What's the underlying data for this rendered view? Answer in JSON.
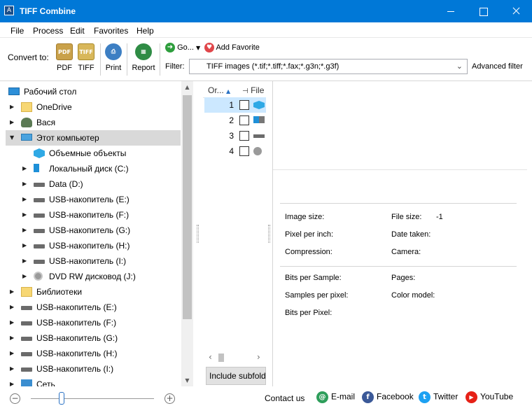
{
  "window": {
    "title": "TIFF Combine",
    "icon_glyph": "A"
  },
  "menu": [
    "File",
    "Process",
    "Edit",
    "Favorites",
    "Help"
  ],
  "toolbar": {
    "convert_label": "Convert to:",
    "buttons": [
      {
        "label": "PDF",
        "icon": "pdf-icon",
        "glyph": "PDF"
      },
      {
        "label": "TIFF",
        "icon": "tiff-icon",
        "glyph": "TIFF"
      },
      {
        "label": "Print",
        "icon": "print-icon",
        "glyph": "⎙"
      },
      {
        "label": "Report",
        "icon": "report-icon",
        "glyph": "▦"
      }
    ],
    "go_label": "Go...",
    "go_glyph": "➜",
    "add_favorite_label": "Add Favorite",
    "fav_glyph": "♥",
    "filter_label": "Filter:",
    "filter_value": "TIFF images (*.tif;*.tiff;*.fax;*.g3n;*.g3f)",
    "advanced_filter_label": "Advanced filter"
  },
  "tree": {
    "items": [
      {
        "label": "Рабочий стол",
        "icon": "desktop-icon",
        "level": 0,
        "arrow": ""
      },
      {
        "label": "OneDrive",
        "icon": "folder-icon",
        "level": 1,
        "arrow": "▶"
      },
      {
        "label": "Вася",
        "icon": "user-icon",
        "level": 1,
        "arrow": "▶"
      },
      {
        "label": "Этот компьютер",
        "icon": "computer-icon",
        "level": 1,
        "arrow": "▼",
        "selected": true
      },
      {
        "label": "Объемные объекты",
        "icon": "3d-objects-icon",
        "level": 2,
        "arrow": ""
      },
      {
        "label": "Локальный диск (C:)",
        "icon": "windows-drive-icon",
        "level": 2,
        "arrow": "▶"
      },
      {
        "label": "Data (D:)",
        "icon": "drive-icon",
        "level": 2,
        "arrow": "▶"
      },
      {
        "label": "USB-накопитель (E:)",
        "icon": "usb-drive-icon",
        "level": 2,
        "arrow": "▶"
      },
      {
        "label": "USB-накопитель (F:)",
        "icon": "usb-drive-icon",
        "level": 2,
        "arrow": "▶"
      },
      {
        "label": "USB-накопитель (G:)",
        "icon": "usb-drive-icon",
        "level": 2,
        "arrow": "▶"
      },
      {
        "label": "USB-накопитель (H:)",
        "icon": "usb-drive-icon",
        "level": 2,
        "arrow": "▶"
      },
      {
        "label": "USB-накопитель (I:)",
        "icon": "usb-drive-icon",
        "level": 2,
        "arrow": "▶"
      },
      {
        "label": "DVD RW дисковод (J:)",
        "icon": "dvd-drive-icon",
        "level": 2,
        "arrow": "▶"
      },
      {
        "label": "Библиотеки",
        "icon": "libraries-icon",
        "level": 1,
        "arrow": "▶"
      },
      {
        "label": "USB-накопитель (E:)",
        "icon": "usb-drive-icon",
        "level": 1,
        "arrow": "▶"
      },
      {
        "label": "USB-накопитель (F:)",
        "icon": "usb-drive-icon",
        "level": 1,
        "arrow": "▶"
      },
      {
        "label": "USB-накопитель (G:)",
        "icon": "usb-drive-icon",
        "level": 1,
        "arrow": "▶"
      },
      {
        "label": "USB-накопитель (H:)",
        "icon": "usb-drive-icon",
        "level": 1,
        "arrow": "▶"
      },
      {
        "label": "USB-накопитель (I:)",
        "icon": "usb-drive-icon",
        "level": 1,
        "arrow": "▶"
      },
      {
        "label": "Сеть",
        "icon": "network-icon",
        "level": 1,
        "arrow": "▶"
      }
    ]
  },
  "filelist": {
    "col_order": "Or...",
    "col_order_sort": "▲",
    "col_file": "File",
    "col_file_glyph": "⊣",
    "rows": [
      {
        "num": "1",
        "icon": "3d-objects-icon",
        "selected": true
      },
      {
        "num": "2",
        "icon": "windows-drive-icon",
        "selected": false
      },
      {
        "num": "3",
        "icon": "drive-icon",
        "selected": false
      },
      {
        "num": "4",
        "icon": "dvd-drive-icon",
        "selected": false
      }
    ],
    "include_subfolders_label": "Include subfolders"
  },
  "info": {
    "image_size_label": "Image size:",
    "file_size_label": "File size:",
    "file_size_value": "-1",
    "ppi_label": "Pixel per inch:",
    "date_taken_label": "Date taken:",
    "compression_label": "Compression:",
    "camera_label": "Camera:",
    "bits_sample_label": "Bits per Sample:",
    "pages_label": "Pages:",
    "samples_pixel_label": "Samples per pixel:",
    "color_model_label": "Color model:",
    "bits_pixel_label": "Bits per Pixel:"
  },
  "status": {
    "zoom_out_glyph": "−",
    "zoom_in_glyph": "+",
    "zoom_level": 0.25,
    "contact_label": "Contact us",
    "links": [
      {
        "label": "E-mail",
        "icon": "email-icon",
        "glyph": "@",
        "color": "#2e9e5b"
      },
      {
        "label": "Facebook",
        "icon": "facebook-icon",
        "glyph": "f",
        "color": "#3b5998"
      },
      {
        "label": "Twitter",
        "icon": "twitter-icon",
        "glyph": "t",
        "color": "#1da1f2"
      },
      {
        "label": "YouTube",
        "icon": "youtube-icon",
        "glyph": "▶",
        "color": "#e62117"
      }
    ]
  },
  "colors": {
    "titlebar": "#0078d7",
    "selection": "#d9d9d9",
    "file_selection": "#cce8ff"
  }
}
